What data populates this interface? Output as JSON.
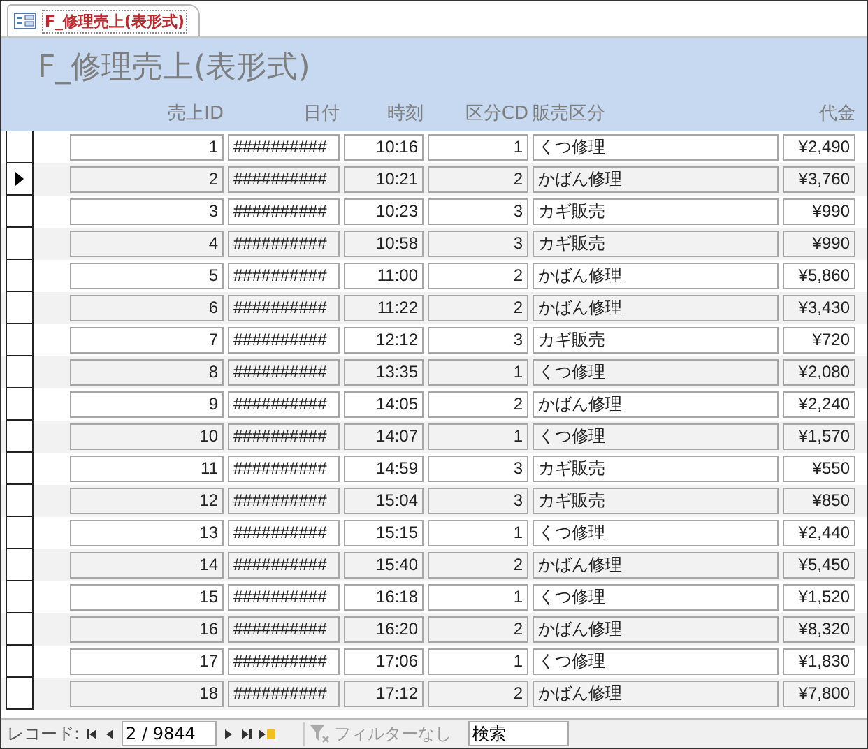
{
  "tab": {
    "label": "F_修理売上(表形式)",
    "selected": true
  },
  "form_title": "F_修理売上(表形式)",
  "columns": [
    "売上ID",
    "日付",
    "時刻",
    "区分CD",
    "販売区分",
    "代金"
  ],
  "rows": [
    {
      "cells": [
        "1",
        "##########",
        "10:16",
        "1",
        "くつ修理",
        "¥2,490"
      ],
      "selected": false
    },
    {
      "cells": [
        "2",
        "##########",
        "10:21",
        "2",
        "かばん修理",
        "¥3,760"
      ],
      "selected": true
    },
    {
      "cells": [
        "3",
        "##########",
        "10:23",
        "3",
        "カギ販売",
        "¥990"
      ],
      "selected": false
    },
    {
      "cells": [
        "4",
        "##########",
        "10:58",
        "3",
        "カギ販売",
        "¥990"
      ],
      "selected": false
    },
    {
      "cells": [
        "5",
        "##########",
        "11:00",
        "2",
        "かばん修理",
        "¥5,860"
      ],
      "selected": false
    },
    {
      "cells": [
        "6",
        "##########",
        "11:22",
        "2",
        "かばん修理",
        "¥3,430"
      ],
      "selected": false
    },
    {
      "cells": [
        "7",
        "##########",
        "12:12",
        "3",
        "カギ販売",
        "¥720"
      ],
      "selected": false
    },
    {
      "cells": [
        "8",
        "##########",
        "13:35",
        "1",
        "くつ修理",
        "¥2,080"
      ],
      "selected": false
    },
    {
      "cells": [
        "9",
        "##########",
        "14:05",
        "2",
        "かばん修理",
        "¥2,240"
      ],
      "selected": false
    },
    {
      "cells": [
        "10",
        "##########",
        "14:07",
        "1",
        "くつ修理",
        "¥1,570"
      ],
      "selected": false
    },
    {
      "cells": [
        "11",
        "##########",
        "14:59",
        "3",
        "カギ販売",
        "¥550"
      ],
      "selected": false
    },
    {
      "cells": [
        "12",
        "##########",
        "15:04",
        "3",
        "カギ販売",
        "¥850"
      ],
      "selected": false
    },
    {
      "cells": [
        "13",
        "##########",
        "15:15",
        "1",
        "くつ修理",
        "¥2,440"
      ],
      "selected": false
    },
    {
      "cells": [
        "14",
        "##########",
        "15:40",
        "2",
        "かばん修理",
        "¥5,450"
      ],
      "selected": false
    },
    {
      "cells": [
        "15",
        "##########",
        "16:18",
        "1",
        "くつ修理",
        "¥1,520"
      ],
      "selected": false
    },
    {
      "cells": [
        "16",
        "##########",
        "16:20",
        "2",
        "かばん修理",
        "¥8,320"
      ],
      "selected": false
    },
    {
      "cells": [
        "17",
        "##########",
        "17:06",
        "1",
        "くつ修理",
        "¥1,830"
      ],
      "selected": false
    },
    {
      "cells": [
        "18",
        "##########",
        "17:12",
        "2",
        "かばん修理",
        "¥7,800"
      ],
      "selected": false
    }
  ],
  "navigation": {
    "label": "レコード:",
    "position": "2 / 9844",
    "filter": {
      "label": "フィルターなし",
      "disabled": true
    },
    "search": {
      "value": "検索"
    }
  }
}
